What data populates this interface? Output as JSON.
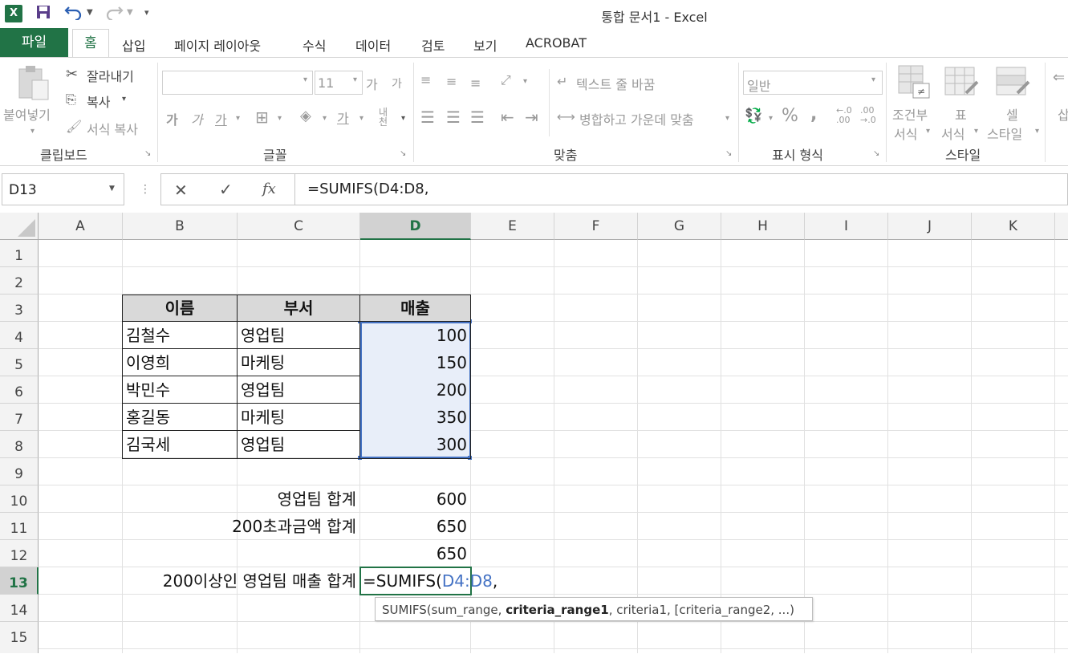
{
  "window": {
    "title": "통합 문서1 - Excel"
  },
  "quick_access": {
    "excel_icon": "excel-logo-icon",
    "save": "save-icon",
    "undo": "undo-icon",
    "redo": "redo-icon",
    "customize": "customize-qat-icon"
  },
  "tabs": {
    "file": "파일",
    "home": "홈",
    "insert": "삽입",
    "page_layout": "페이지 레이아웃",
    "formulas": "수식",
    "data": "데이터",
    "review": "검토",
    "view": "보기",
    "acrobat": "ACROBAT"
  },
  "ribbon": {
    "clipboard": {
      "paste": "붙여넣기",
      "cut": "잘라내기",
      "copy": "복사",
      "format_painter": "서식 복사",
      "label": "클립보드"
    },
    "font": {
      "size": "11",
      "bold": "가",
      "italic": "가",
      "underline": "가",
      "font_color_glyph": "가",
      "grow": "가",
      "shrink": "가",
      "phonetic": "내천",
      "label": "글꼴"
    },
    "alignment": {
      "wrap_text": "텍스트 줄 바꿈",
      "merge_center": "병합하고 가운데 맞춤",
      "label": "맞춤"
    },
    "number": {
      "format": "일반",
      "percent": "%",
      "comma": ",",
      "inc_decimal": "←.0 .00",
      "dec_decimal": ".00 →.0",
      "label": "표시 형식"
    },
    "styles": {
      "conditional_1": "조건부",
      "conditional_2": "서식",
      "table_1": "표",
      "table_2": "서식",
      "cell_1": "셀",
      "cell_2": "스타일",
      "label": "스타일",
      "insert_partial": "삽"
    }
  },
  "formula_bar": {
    "name_box": "D13",
    "cancel": "✕",
    "enter": "✓",
    "fx": "fx",
    "content": "=SUMIFS(D4:D8,"
  },
  "columns": [
    "A",
    "B",
    "C",
    "D",
    "E",
    "F",
    "G",
    "H",
    "I",
    "J",
    "K"
  ],
  "rows": [
    "1",
    "2",
    "3",
    "4",
    "5",
    "6",
    "7",
    "8",
    "9",
    "10",
    "11",
    "12",
    "13",
    "14",
    "15"
  ],
  "table": {
    "headers": [
      "이름",
      "부서",
      "매출"
    ],
    "rows": [
      [
        "김철수",
        "영업팀",
        "100"
      ],
      [
        "이영희",
        "마케팅",
        "150"
      ],
      [
        "박민수",
        "영업팀",
        "200"
      ],
      [
        "홍길동",
        "마케팅",
        "350"
      ],
      [
        "김국세",
        "영업팀",
        "300"
      ]
    ]
  },
  "summary": {
    "r10_label": "영업팀 합계",
    "r10_value": "600",
    "r11_label": "200초과금액 합계",
    "r11_value": "650",
    "r12_value": "650",
    "r13_label": "200이상인 영업팀 매출 합계",
    "r13_prefix": "=SUMIFS(",
    "r13_ref": "D4:D8",
    "r13_suffix": ","
  },
  "tooltip": {
    "prefix": "SUMIFS(sum_range, ",
    "bold": "criteria_range1",
    "suffix": ", criteria1, [criteria_range2, ...)"
  },
  "colors": {
    "excel_green": "#217346",
    "ref_blue": "#4472c4",
    "selection_fill": "#e8eef9"
  }
}
